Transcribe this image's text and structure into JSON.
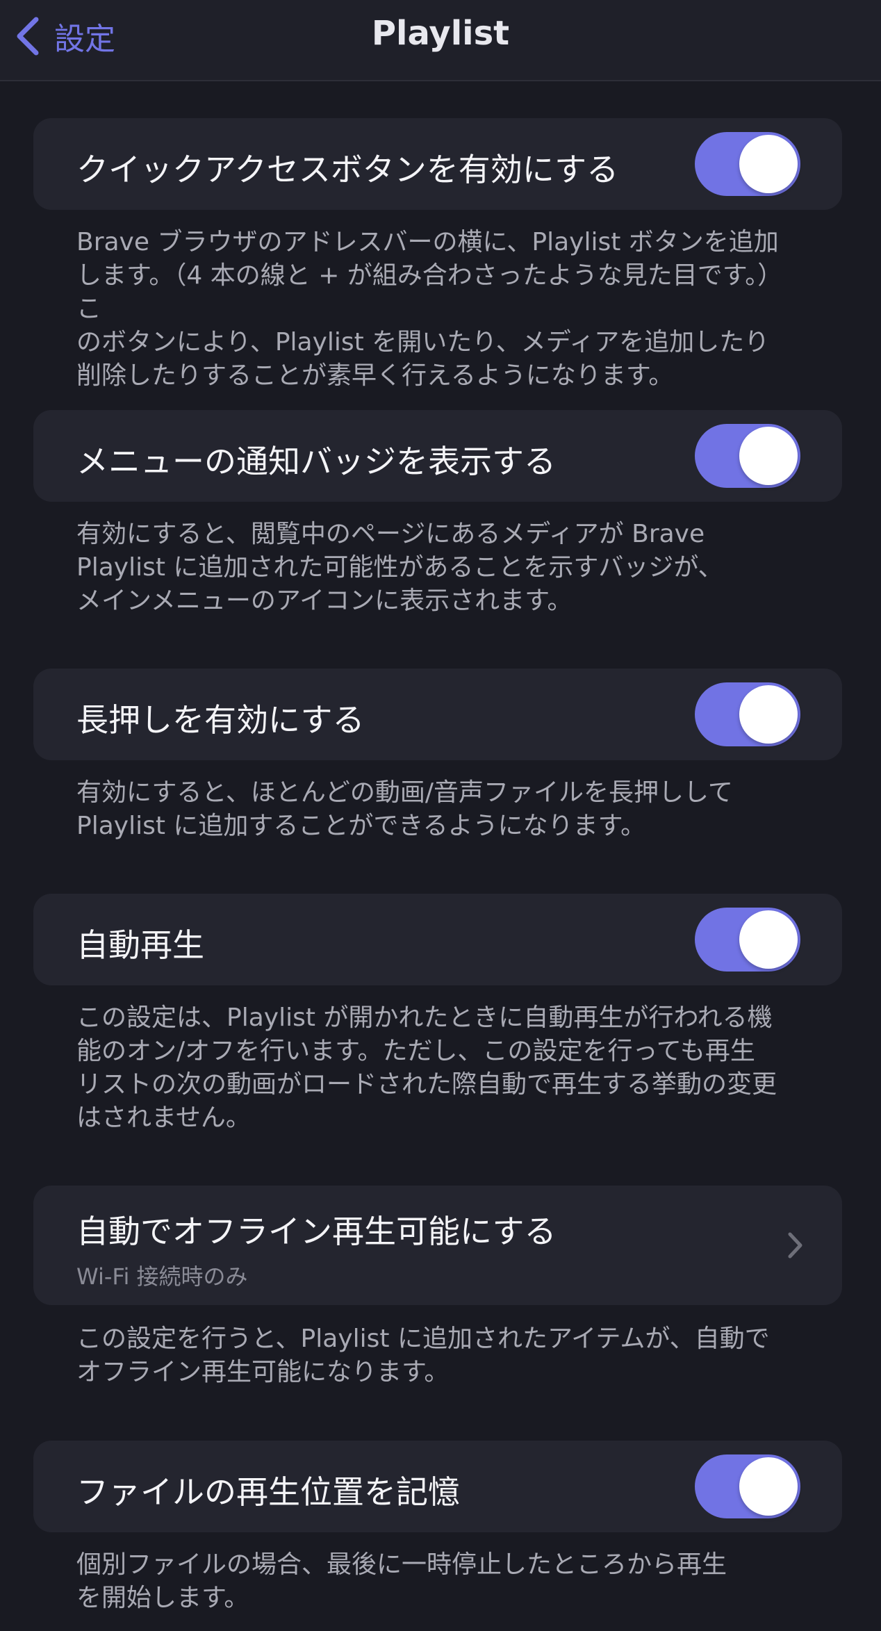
{
  "nav": {
    "back_label": "設定",
    "title": "Playlist"
  },
  "colors": {
    "accent": "#7173e4",
    "background": "#191a22",
    "card": "#24252f",
    "footer_text": "#a9aab4"
  },
  "settings": [
    {
      "label": "クイックアクセスボタンを有効にする",
      "control": "toggle",
      "on": true,
      "footer": "Brave ブラウザのアドレスバーの横に、Playlist ボタンを追加\nします。（4 本の線と + が組み合わさったような見た目です。）こ\nのボタンにより、Playlist を開いたり、メディアを追加したり\n削除したりすることが素早く行えるようになります。"
    },
    {
      "label": "メニューの通知バッジを表示する",
      "control": "toggle",
      "on": true,
      "footer": "有効にすると、閲覧中のページにあるメディアが Brave\nPlaylist に追加された可能性があることを示すバッジが、\nメインメニューのアイコンに表示されます。"
    },
    {
      "label": "長押しを有効にする",
      "control": "toggle",
      "on": true,
      "footer": "有効にすると、ほとんどの動画/音声ファイルを長押しして\nPlaylist に追加することができるようになります。"
    },
    {
      "label": "自動再生",
      "control": "toggle",
      "on": true,
      "footer": "この設定は、Playlist が開かれたときに自動再生が行われる機\n能のオン/オフを行います。ただし、この設定を行っても再生\nリストの次の動画がロードされた際自動で再生する挙動の変更\nはされません。"
    },
    {
      "label": "自動でオフライン再生可能にする",
      "sublabel": "Wi-Fi 接続時のみ",
      "control": "chevron",
      "footer": "この設定を行うと、Playlist に追加されたアイテムが、自動で\nオフライン再生可能になります。"
    },
    {
      "label": "ファイルの再生位置を記憶",
      "control": "toggle",
      "on": true,
      "footer": "個別ファイルの場合、最後に一時停止したところから再生\nを開始します。"
    }
  ]
}
